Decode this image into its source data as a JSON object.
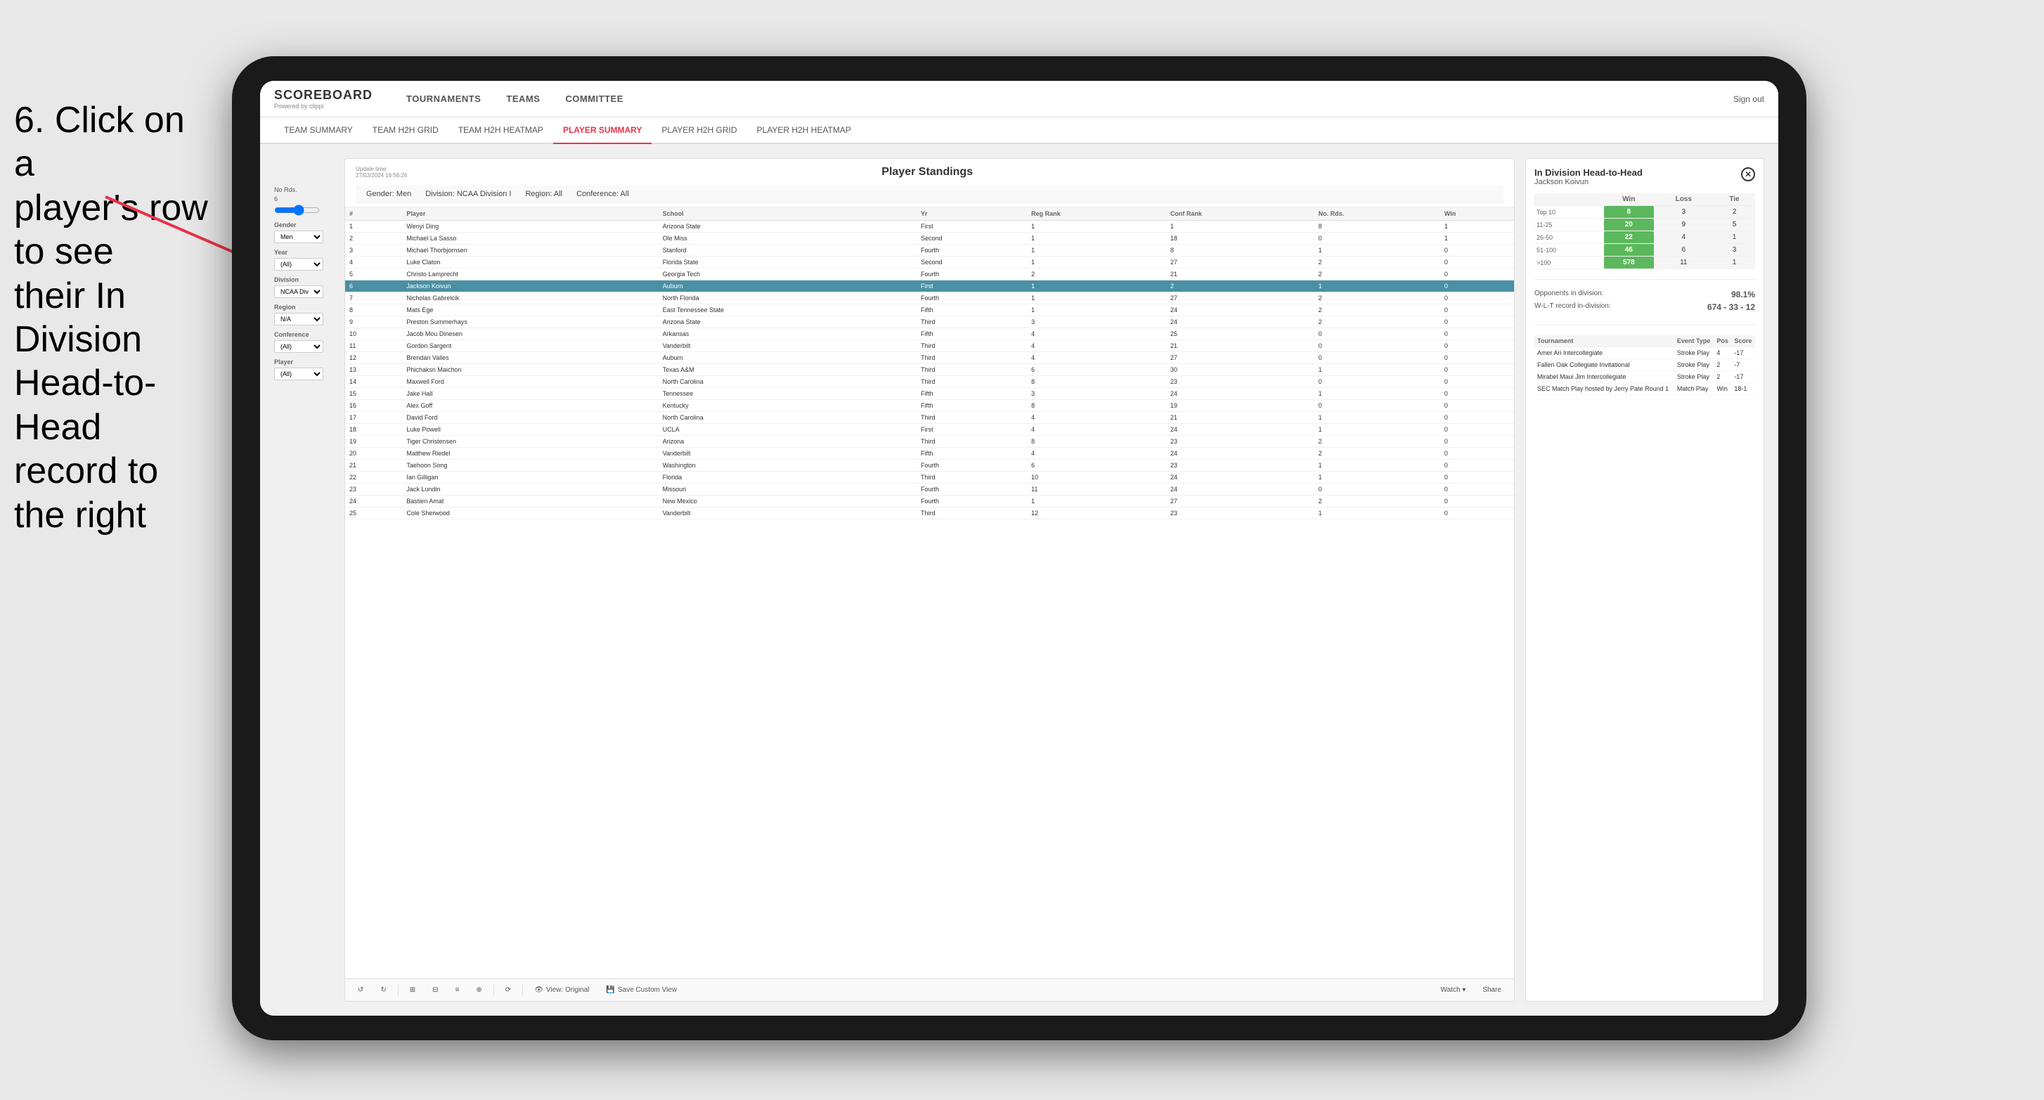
{
  "instruction": {
    "line1": "6. Click on a",
    "line2": "player's row to see",
    "line3": "their In Division",
    "line4": "Head-to-Head",
    "line5": "record to the right"
  },
  "nav": {
    "logo": "SCOREBOARD",
    "powered_by": "Powered by clippi",
    "items": [
      "TOURNAMENTS",
      "TEAMS",
      "COMMITTEE"
    ],
    "sign_out": "Sign out"
  },
  "sub_nav": {
    "items": [
      "TEAM SUMMARY",
      "TEAM H2H GRID",
      "TEAM H2H HEATMAP",
      "PLAYER SUMMARY",
      "PLAYER H2H GRID",
      "PLAYER H2H HEATMAP"
    ],
    "active": "PLAYER SUMMARY"
  },
  "panel": {
    "title": "Player Standings",
    "update_time": "Update time:",
    "update_date": "27/03/2024 16:56:26",
    "gender": "Gender: Men",
    "division": "Division: NCAA Division I",
    "region": "Region: All",
    "conference": "Conference: All"
  },
  "sidebar": {
    "no_rds_label": "No Rds.",
    "no_rds_value": "6",
    "gender_label": "Gender",
    "gender_value": "Men",
    "year_label": "Year",
    "year_value": "(All)",
    "division_label": "Division",
    "division_value": "NCAA Division I",
    "region_label": "Region",
    "region_value": "N/A",
    "conference_label": "Conference",
    "conference_value": "(All)",
    "player_label": "Player",
    "player_value": "(All)"
  },
  "table": {
    "headers": [
      "#",
      "Player",
      "School",
      "Yr",
      "Reg Rank",
      "Conf Rank",
      "No. Rds.",
      "Win"
    ],
    "rows": [
      {
        "num": 1,
        "player": "Wenyi Ding",
        "school": "Arizona State",
        "yr": "First",
        "reg": 1,
        "conf": 1,
        "rds": 8,
        "win": 1,
        "selected": false
      },
      {
        "num": 2,
        "player": "Michael La Sasso",
        "school": "Ole Miss",
        "yr": "Second",
        "reg": 1,
        "conf": 18,
        "rds": 0,
        "win": 1,
        "selected": false
      },
      {
        "num": 3,
        "player": "Michael Thorbjornsen",
        "school": "Stanford",
        "yr": "Fourth",
        "reg": 1,
        "conf": 8,
        "rds": 1,
        "win": 0,
        "selected": false
      },
      {
        "num": 4,
        "player": "Luke Claton",
        "school": "Florida State",
        "yr": "Second",
        "reg": 1,
        "conf": 27,
        "rds": 2,
        "win": 0,
        "selected": false
      },
      {
        "num": 5,
        "player": "Christo Lamprecht",
        "school": "Georgia Tech",
        "yr": "Fourth",
        "reg": 2,
        "conf": 21,
        "rds": 2,
        "win": 0,
        "selected": false
      },
      {
        "num": 6,
        "player": "Jackson Koivun",
        "school": "Auburn",
        "yr": "First",
        "reg": 1,
        "conf": 2,
        "rds": 1,
        "win": 0,
        "selected": true
      },
      {
        "num": 7,
        "player": "Nicholas Gabrelcik",
        "school": "North Florida",
        "yr": "Fourth",
        "reg": 1,
        "conf": 27,
        "rds": 2,
        "win": 0,
        "selected": false
      },
      {
        "num": 8,
        "player": "Mats Ege",
        "school": "East Tennessee State",
        "yr": "Fifth",
        "reg": 1,
        "conf": 24,
        "rds": 2,
        "win": 0,
        "selected": false
      },
      {
        "num": 9,
        "player": "Preston Summerhays",
        "school": "Arizona State",
        "yr": "Third",
        "reg": 3,
        "conf": 24,
        "rds": 2,
        "win": 0,
        "selected": false
      },
      {
        "num": 10,
        "player": "Jacob Mou Dinesen",
        "school": "Arkansas",
        "yr": "Fifth",
        "reg": 4,
        "conf": 25,
        "rds": 0,
        "win": 0,
        "selected": false
      },
      {
        "num": 11,
        "player": "Gordon Sargent",
        "school": "Vanderbilt",
        "yr": "Third",
        "reg": 4,
        "conf": 21,
        "rds": 0,
        "win": 0,
        "selected": false
      },
      {
        "num": 12,
        "player": "Brendan Valles",
        "school": "Auburn",
        "yr": "Third",
        "reg": 4,
        "conf": 27,
        "rds": 0,
        "win": 0,
        "selected": false
      },
      {
        "num": 13,
        "player": "Phichaksn Maichon",
        "school": "Texas A&M",
        "yr": "Third",
        "reg": 6,
        "conf": 30,
        "rds": 1,
        "win": 0,
        "selected": false
      },
      {
        "num": 14,
        "player": "Maxwell Ford",
        "school": "North Carolina",
        "yr": "Third",
        "reg": 8,
        "conf": 23,
        "rds": 0,
        "win": 0,
        "selected": false
      },
      {
        "num": 15,
        "player": "Jake Hall",
        "school": "Tennessee",
        "yr": "Fifth",
        "reg": 3,
        "conf": 24,
        "rds": 1,
        "win": 0,
        "selected": false
      },
      {
        "num": 16,
        "player": "Alex Goff",
        "school": "Kentucky",
        "yr": "Fifth",
        "reg": 8,
        "conf": 19,
        "rds": 0,
        "win": 0,
        "selected": false
      },
      {
        "num": 17,
        "player": "David Ford",
        "school": "North Carolina",
        "yr": "Third",
        "reg": 4,
        "conf": 21,
        "rds": 1,
        "win": 0,
        "selected": false
      },
      {
        "num": 18,
        "player": "Luke Powell",
        "school": "UCLA",
        "yr": "First",
        "reg": 4,
        "conf": 24,
        "rds": 1,
        "win": 0,
        "selected": false
      },
      {
        "num": 19,
        "player": "Tiger Christensen",
        "school": "Arizona",
        "yr": "Third",
        "reg": 8,
        "conf": 23,
        "rds": 2,
        "win": 0,
        "selected": false
      },
      {
        "num": 20,
        "player": "Matthew Riedel",
        "school": "Vanderbilt",
        "yr": "Fifth",
        "reg": 4,
        "conf": 24,
        "rds": 2,
        "win": 0,
        "selected": false
      },
      {
        "num": 21,
        "player": "Taehoon Song",
        "school": "Washington",
        "yr": "Fourth",
        "reg": 6,
        "conf": 23,
        "rds": 1,
        "win": 0,
        "selected": false
      },
      {
        "num": 22,
        "player": "Ian Gilligan",
        "school": "Florida",
        "yr": "Third",
        "reg": 10,
        "conf": 24,
        "rds": 1,
        "win": 0,
        "selected": false
      },
      {
        "num": 23,
        "player": "Jack Lundin",
        "school": "Missouri",
        "yr": "Fourth",
        "reg": 11,
        "conf": 24,
        "rds": 0,
        "win": 0,
        "selected": false
      },
      {
        "num": 24,
        "player": "Bastien Amat",
        "school": "New Mexico",
        "yr": "Fourth",
        "reg": 1,
        "conf": 27,
        "rds": 2,
        "win": 0,
        "selected": false
      },
      {
        "num": 25,
        "player": "Cole Sherwood",
        "school": "Vanderbilt",
        "yr": "Third",
        "reg": 12,
        "conf": 23,
        "rds": 1,
        "win": 0,
        "selected": false
      }
    ]
  },
  "toolbar": {
    "view_original": "View: Original",
    "save_custom": "Save Custom View",
    "watch": "Watch ▾",
    "share": "Share"
  },
  "h2h": {
    "title": "In Division Head-to-Head",
    "player": "Jackson Koivun",
    "headers": [
      "Win",
      "Loss",
      "Tie"
    ],
    "rows": [
      {
        "range": "Top 10",
        "win": 8,
        "loss": 3,
        "tie": 2
      },
      {
        "range": "11-25",
        "win": 20,
        "loss": 9,
        "tie": 5
      },
      {
        "range": "26-50",
        "win": 22,
        "loss": 4,
        "tie": 1
      },
      {
        "range": "51-100",
        "win": 46,
        "loss": 6,
        "tie": 3
      },
      {
        "range": ">100",
        "win": 578,
        "loss": 11,
        "tie": 1
      }
    ],
    "opponents_label": "Opponents in division:",
    "wlt_label": "W-L-T record in-division:",
    "opponents_value": "98.1%",
    "wlt_value": "674 - 33 - 12",
    "tournament_headers": [
      "Tournament",
      "Event Type",
      "Pos",
      "Score"
    ],
    "tournaments": [
      {
        "name": "Amer Ari Intercollegiate",
        "type": "Stroke Play",
        "pos": 4,
        "score": "-17"
      },
      {
        "name": "Fallen Oak Collegiate Invitational",
        "type": "Stroke Play",
        "pos": 2,
        "score": "-7"
      },
      {
        "name": "Mirabel Maui Jim Intercollegiate",
        "type": "Stroke Play",
        "pos": 2,
        "score": "-17"
      },
      {
        "name": "SEC Match Play hosted by Jerry Pate Round 1",
        "type": "Match Play",
        "pos": "Win",
        "score": "18-1"
      }
    ]
  }
}
